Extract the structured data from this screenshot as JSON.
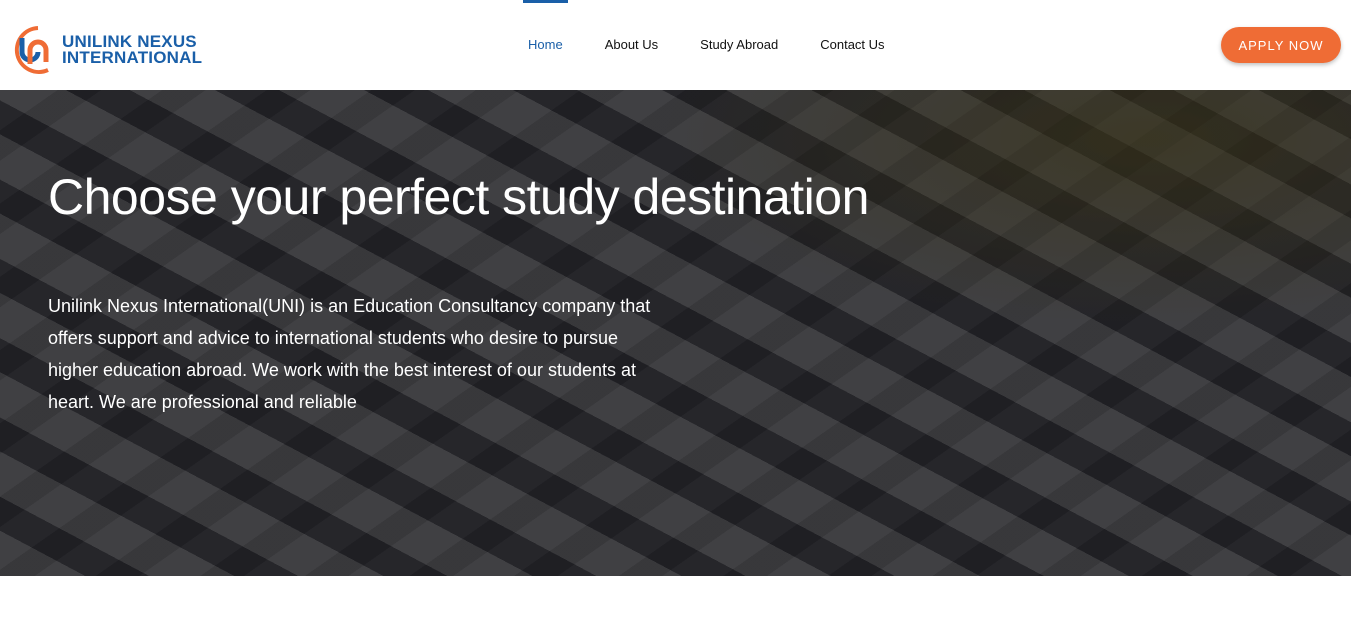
{
  "brand": {
    "line1": "UNILINK NEXUS",
    "line2": "INTERNATIONAL"
  },
  "nav": [
    {
      "label": "Home"
    },
    {
      "label": "About Us"
    },
    {
      "label": "Study Abroad"
    },
    {
      "label": "Contact Us"
    }
  ],
  "cta": "APPLY NOW",
  "hero": {
    "title": "Choose your perfect study destination",
    "text": "Unilink Nexus International(UNI) is an Education Consultancy company that offers support and advice to international students who desire to pursue higher education abroad. We work with the best interest of our students at heart. We are professional and reliable"
  }
}
